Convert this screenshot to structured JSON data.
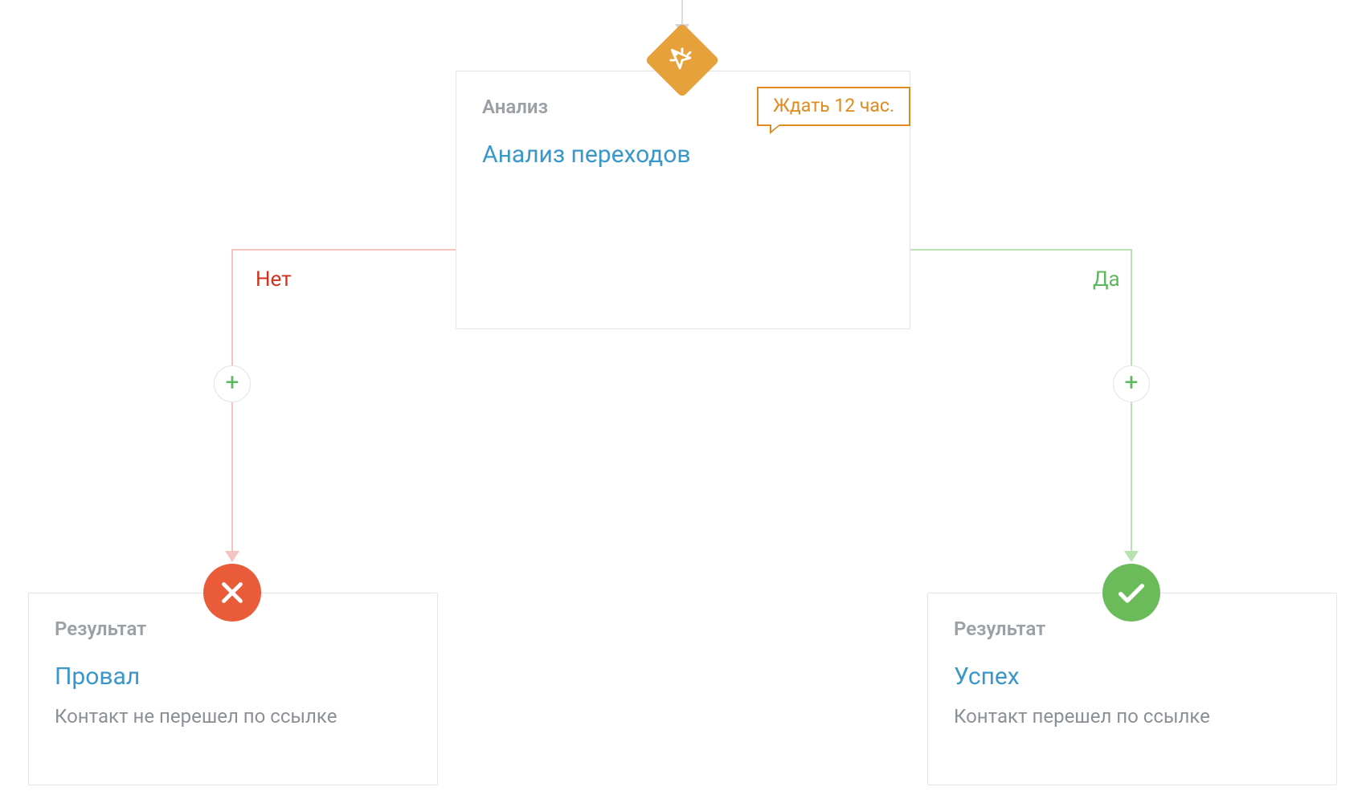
{
  "analysis": {
    "type_label": "Анализ",
    "title": "Анализ переходов",
    "wait_tag": "Ждать 12 час."
  },
  "branches": {
    "no_label": "Нет",
    "yes_label": "Да",
    "add_glyph": "+"
  },
  "fail": {
    "type_label": "Результат",
    "title": "Провал",
    "subtitle": "Контакт не перешел по ссылке"
  },
  "success": {
    "type_label": "Результат",
    "title": "Успех",
    "subtitle": "Контакт перешел по ссылке"
  }
}
